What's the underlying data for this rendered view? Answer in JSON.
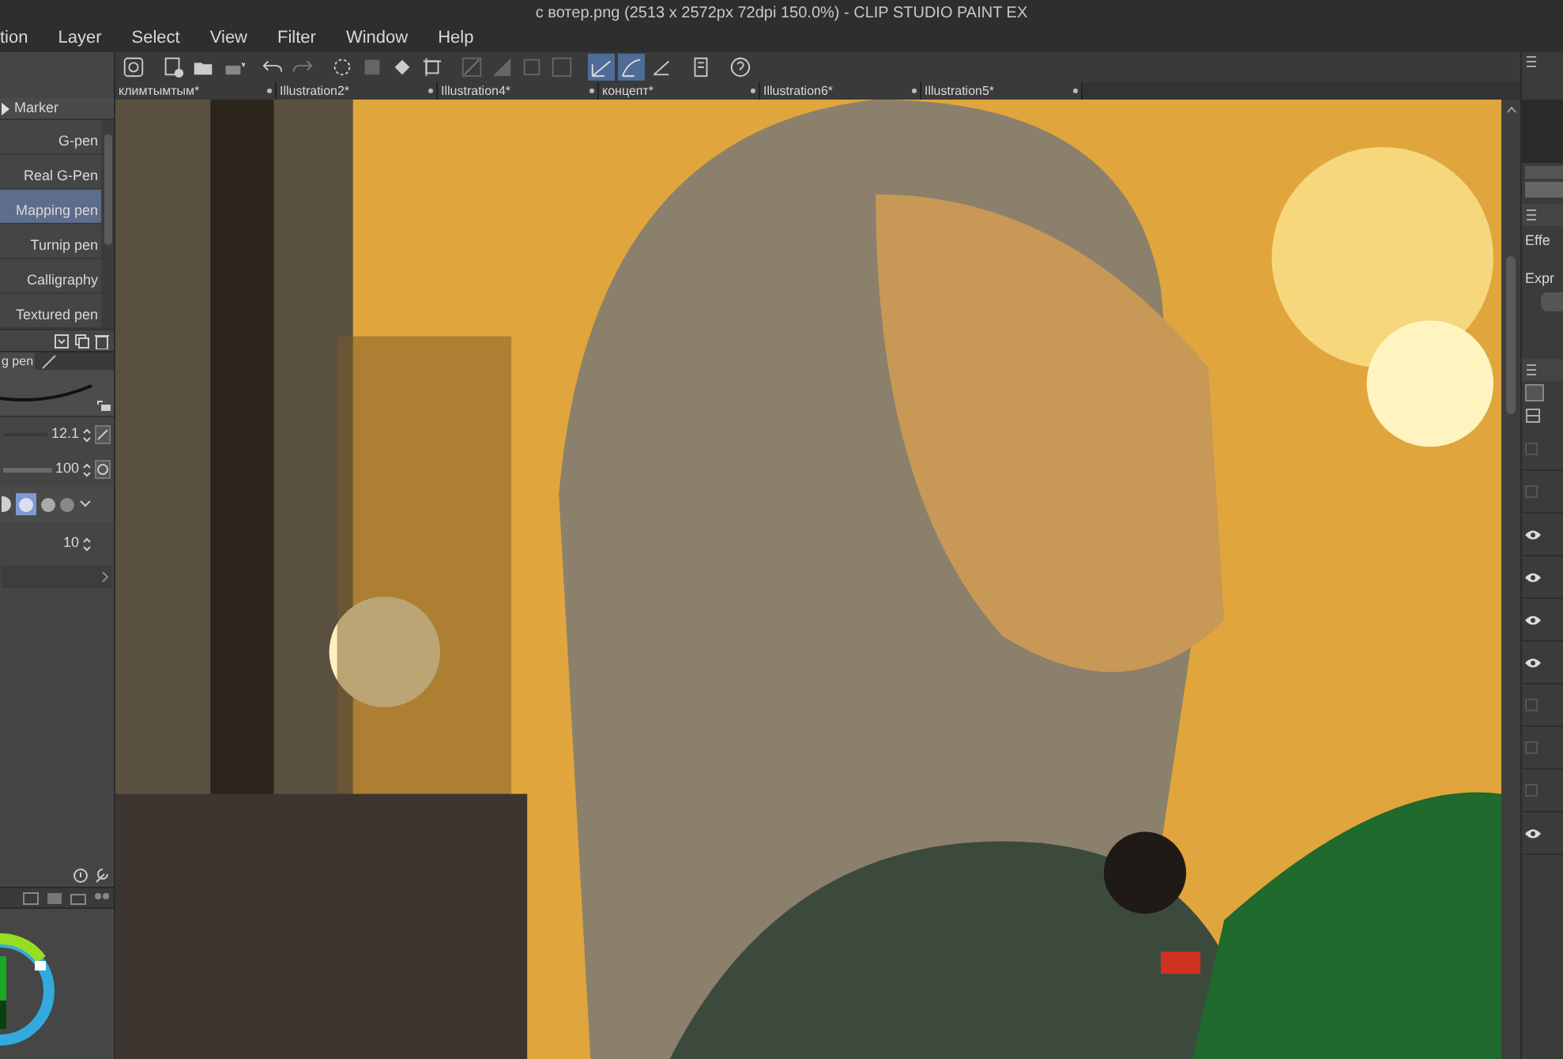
{
  "window": {
    "title": "с вотер.png (2513 x 2572px 72dpi 150.0%) - CLIP STUDIO PAINT EX"
  },
  "menu": [
    "tion",
    "Layer",
    "Select",
    "View",
    "Filter",
    "Window",
    "Help"
  ],
  "toolbar_buttons": [
    {
      "selected": false
    },
    {
      "selected": false
    },
    {
      "selected": false
    },
    {
      "selected": false
    },
    {
      "selected": false
    },
    {
      "selected": false
    },
    {
      "selected": false
    },
    {
      "selected": false
    },
    {
      "selected": false
    },
    {
      "selected": false
    },
    {
      "selected": false
    },
    {
      "selected": false
    },
    {
      "selected": false
    },
    {
      "selected": false
    },
    {
      "selected": true
    },
    {
      "selected": true
    },
    {
      "selected": false
    },
    {
      "selected": false
    },
    {
      "selected": false
    }
  ],
  "document_tabs": [
    "климтымтым*",
    "Illustration2*",
    "Illustration4*",
    "концепт*",
    "Illustration6*",
    "Illustration5*"
  ],
  "sub_tool": {
    "group": "Marker",
    "items": [
      {
        "label": "G-pen",
        "selected": false
      },
      {
        "label": "Real G-Pen",
        "selected": false
      },
      {
        "label": "Mapping pen",
        "selected": true
      },
      {
        "label": "Turnip pen",
        "selected": false
      },
      {
        "label": "Calligraphy",
        "selected": false
      },
      {
        "label": "Textured pen",
        "selected": false
      }
    ]
  },
  "tool_property": {
    "tab": "g pen",
    "size": "12.1",
    "opacity": "100",
    "stabilization": "10"
  },
  "canvas": {
    "kind": "picture"
  },
  "right_panel": {
    "effect_label": "Effe",
    "expression_label": "Expr",
    "layers": [
      {
        "visible": false
      },
      {
        "visible": false
      },
      {
        "visible": true
      },
      {
        "visible": true
      },
      {
        "visible": true
      },
      {
        "visible": true
      },
      {
        "visible": false
      },
      {
        "visible": false
      },
      {
        "visible": false
      },
      {
        "visible": true
      }
    ]
  }
}
